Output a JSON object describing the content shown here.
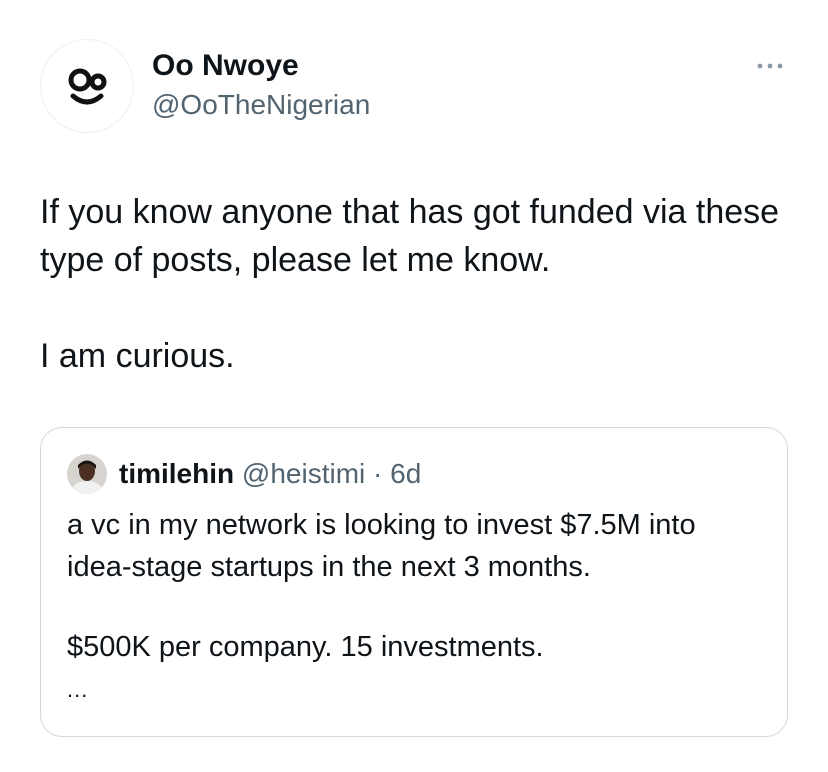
{
  "tweet": {
    "author": {
      "display_name": "Oo Nwoye",
      "handle": "@OoTheNigerian",
      "avatar_icon": "smiley-face-avatar-icon"
    },
    "more_icon": "more-options-icon",
    "text_paragraphs": [
      "If you know anyone that has got funded via these type of posts, please let me know.",
      "I am curious."
    ]
  },
  "quoted_tweet": {
    "author": {
      "display_name": "timilehin",
      "handle": "@heistimi",
      "separator": "·",
      "time": "6d",
      "avatar_icon": "profile-photo-avatar-icon"
    },
    "text_paragraphs": [
      "a vc in my network is looking to invest $7.5M into idea-stage startups in the next 3 months.",
      "$500K per company. 15 investments."
    ],
    "truncation": "..."
  },
  "colors": {
    "text_primary": "#0f1419",
    "text_secondary": "#536471",
    "border": "#cfd9de",
    "background": "#ffffff"
  }
}
